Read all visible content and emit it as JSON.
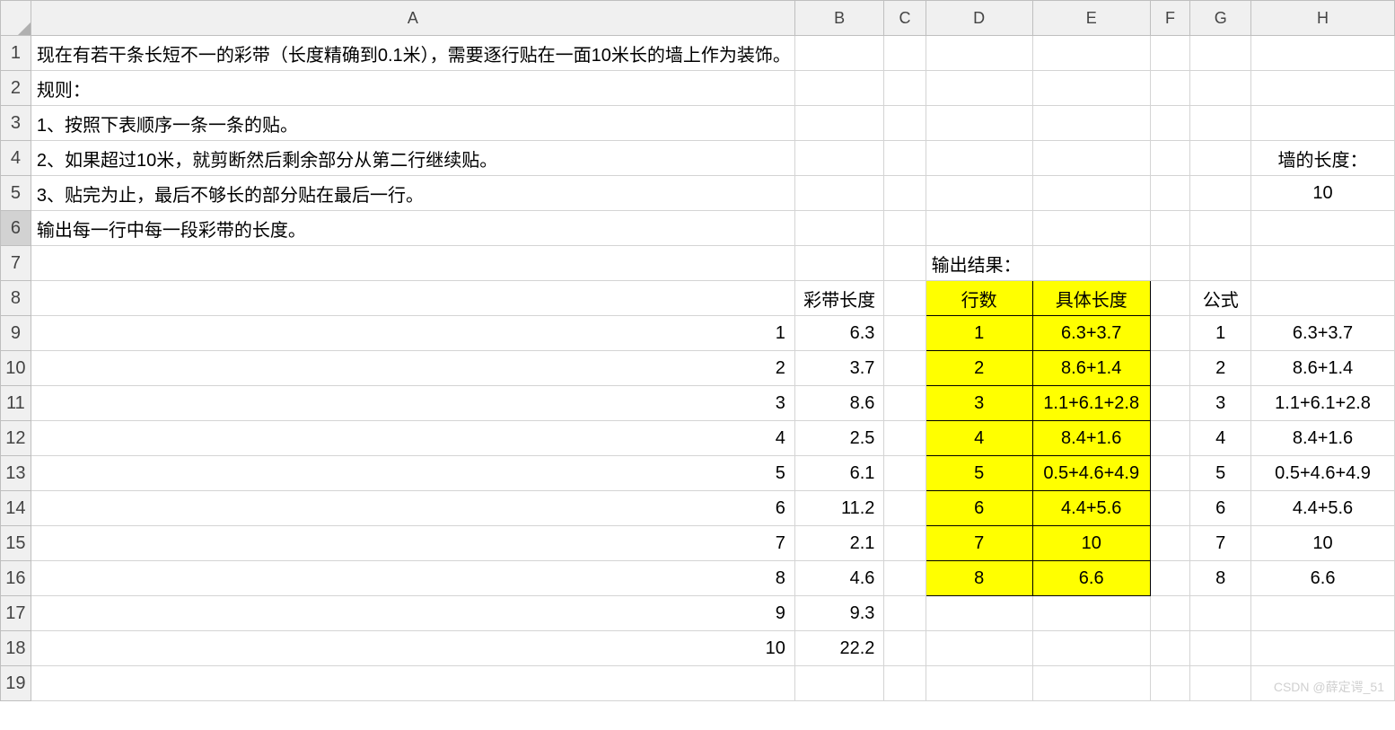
{
  "columns": [
    "A",
    "B",
    "C",
    "D",
    "E",
    "F",
    "G",
    "H"
  ],
  "row_headers": [
    "1",
    "2",
    "3",
    "4",
    "5",
    "6",
    "7",
    "8",
    "9",
    "10",
    "11",
    "12",
    "13",
    "14",
    "15",
    "16",
    "17",
    "18",
    "19"
  ],
  "selected_row": "6",
  "text": {
    "r1": "现在有若干条长短不一的彩带（长度精确到0.1米），需要逐行贴在一面10米长的墙上作为装饰。",
    "r2": "规则：",
    "r3": "1、按照下表顺序一条一条的贴。",
    "r4": "2、如果超过10米，就剪断然后剩余部分从第二行继续贴。",
    "r5": "3、贴完为止，最后不够长的部分贴在最后一行。",
    "r6": "输出每一行中每一段彩带的长度。",
    "output_label": "输出结果：",
    "wall_label": "墙的长度：",
    "wall_length": "10",
    "ribbon_header": "彩带长度",
    "rowcount_header": "行数",
    "detail_header": "具体长度",
    "formula_header": "公式"
  },
  "ribbons": [
    {
      "idx": "1",
      "len": "6.3"
    },
    {
      "idx": "2",
      "len": "3.7"
    },
    {
      "idx": "3",
      "len": "8.6"
    },
    {
      "idx": "4",
      "len": "2.5"
    },
    {
      "idx": "5",
      "len": "6.1"
    },
    {
      "idx": "6",
      "len": "11.2"
    },
    {
      "idx": "7",
      "len": "2.1"
    },
    {
      "idx": "8",
      "len": "4.6"
    },
    {
      "idx": "9",
      "len": "9.3"
    },
    {
      "idx": "10",
      "len": "22.2"
    }
  ],
  "output": [
    {
      "row": "1",
      "detail": "6.3+3.7"
    },
    {
      "row": "2",
      "detail": "8.6+1.4"
    },
    {
      "row": "3",
      "detail": "1.1+6.1+2.8"
    },
    {
      "row": "4",
      "detail": "8.4+1.6"
    },
    {
      "row": "5",
      "detail": "0.5+4.6+4.9"
    },
    {
      "row": "6",
      "detail": "4.4+5.6"
    },
    {
      "row": "7",
      "detail": "10"
    },
    {
      "row": "8",
      "detail": "6.6"
    }
  ],
  "formula": [
    {
      "row": "1",
      "detail": "6.3+3.7"
    },
    {
      "row": "2",
      "detail": "8.6+1.4"
    },
    {
      "row": "3",
      "detail": "1.1+6.1+2.8"
    },
    {
      "row": "4",
      "detail": "8.4+1.6"
    },
    {
      "row": "5",
      "detail": "0.5+4.6+4.9"
    },
    {
      "row": "6",
      "detail": "4.4+5.6"
    },
    {
      "row": "7",
      "detail": "10"
    },
    {
      "row": "8",
      "detail": "6.6"
    }
  ],
  "watermark": "CSDN @薛定谔_51"
}
